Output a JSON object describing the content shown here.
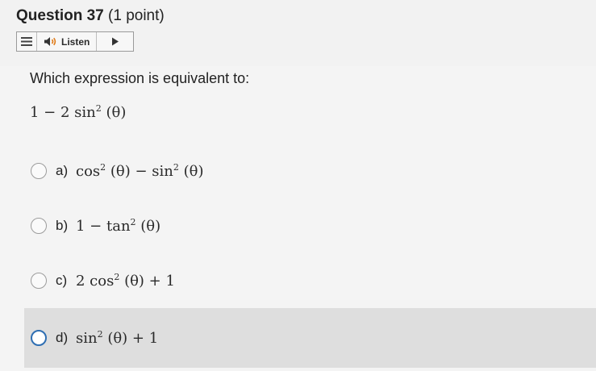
{
  "question": {
    "title_bold": "Question 37",
    "title_rest": " (1 point)"
  },
  "listen_toolbar": {
    "menu_icon": "hamburger-menu-icon",
    "speaker_icon": "speaker-icon",
    "listen_label": "Listen",
    "play_icon": "play-icon"
  },
  "prompt": "Which expression is equivalent to:",
  "expression": {
    "pre": "1 − 2 sin",
    "exp": "2",
    "post": " (θ)"
  },
  "options": [
    {
      "letter": "a)",
      "parts": [
        "cos",
        "2",
        " (θ) − sin",
        "2",
        " (θ)"
      ]
    },
    {
      "letter": "b)",
      "parts": [
        "1 − tan",
        "2",
        " (θ)"
      ]
    },
    {
      "letter": "c)",
      "parts": [
        "2 cos",
        "2",
        " (θ) + 1"
      ]
    },
    {
      "letter": "d)",
      "parts": [
        "sin",
        "2",
        " (θ) + 1"
      ]
    }
  ],
  "colors": {
    "selected_radio": "#2f6fb3",
    "hover_row": "#dedede"
  }
}
